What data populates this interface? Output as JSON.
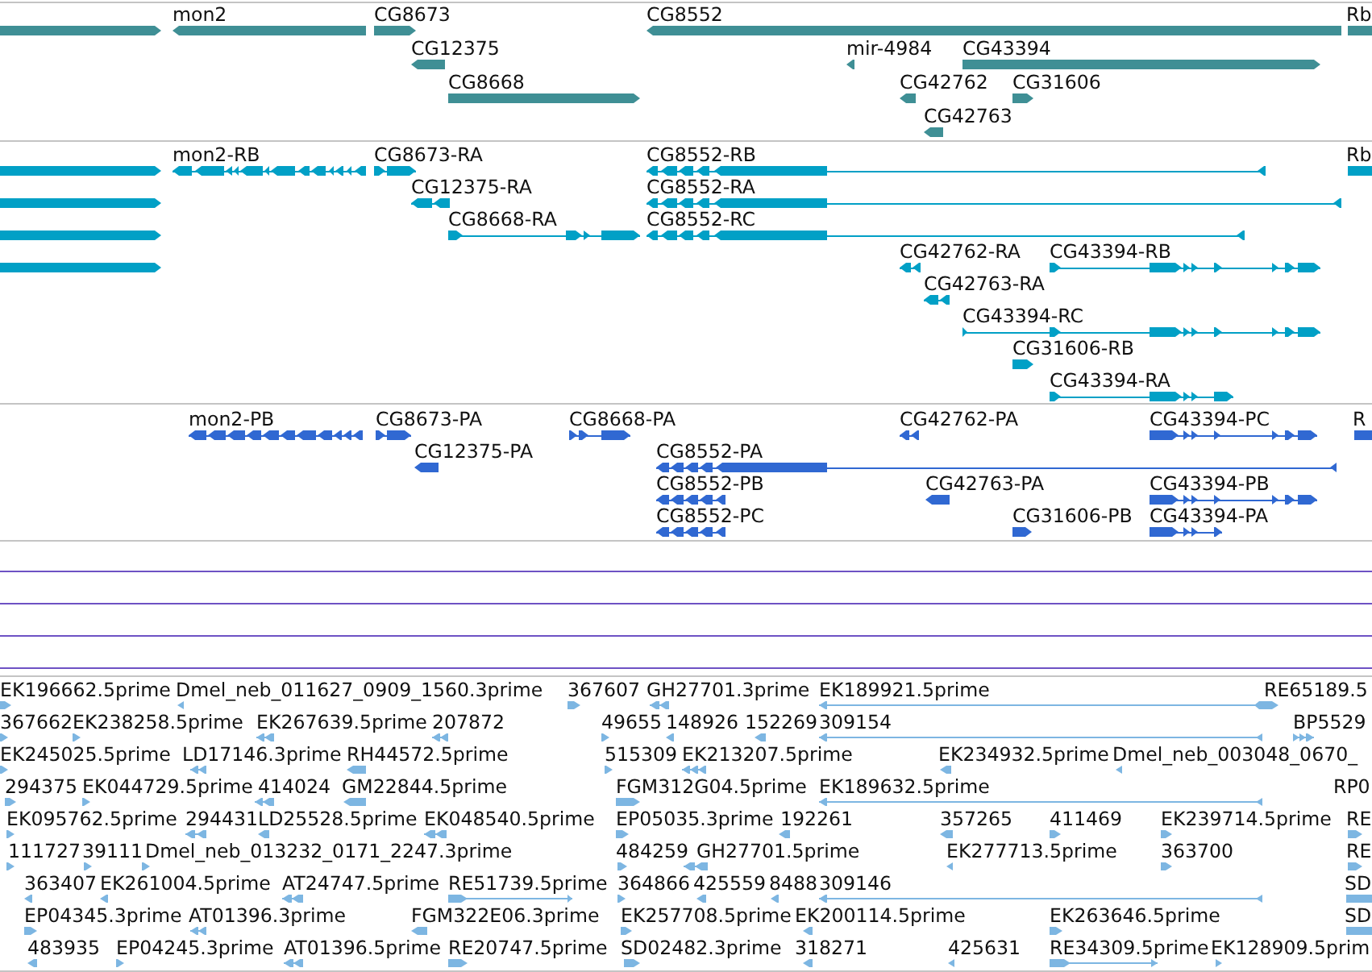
{
  "tracks": [
    {
      "kind": "genes",
      "color": "#3f8f95",
      "features": [
        {
          "reverse": false
        },
        {
          "label": "mon2",
          "reverse": true
        },
        {
          "label": "CG8673",
          "reverse": false
        },
        {
          "label": "CG8552",
          "reverse": true
        },
        {
          "label": "Rb"
        },
        {
          "label": "CG12375",
          "reverse": true
        },
        {
          "label": "mir-4984",
          "reverse": true
        },
        {
          "label": "CG43394",
          "reverse": false
        },
        {
          "label": "CG8668",
          "reverse": false
        },
        {
          "label": "CG42762",
          "reverse": true
        },
        {
          "label": "CG31606",
          "reverse": false
        },
        {
          "label": "CG42763",
          "reverse": true
        }
      ]
    },
    {
      "kind": "transcripts",
      "color": "#01a0c6",
      "features": [
        {
          "reverse": false
        },
        {
          "label": "mon2-RB",
          "reverse": true
        },
        {
          "label": "CG8673-RA",
          "reverse": false
        },
        {
          "label": "CG8552-RB",
          "reverse": true
        },
        {
          "label": "Rb"
        },
        {
          "reverse": false
        },
        {
          "label": "CG12375-RA",
          "reverse": true
        },
        {
          "label": "CG8552-RA",
          "reverse": true
        },
        {
          "reverse": false
        },
        {
          "label": "CG8668-RA",
          "reverse": false
        },
        {
          "label": "CG8552-RC",
          "reverse": true
        },
        {
          "reverse": false
        },
        {
          "label": "CG42762-RA",
          "reverse": true
        },
        {
          "label": "CG43394-RB",
          "reverse": false
        },
        {
          "label": "CG42763-RA",
          "reverse": true
        },
        {
          "label": "CG43394-RC",
          "reverse": false
        },
        {
          "label": "CG31606-RB",
          "reverse": false
        },
        {
          "label": "CG43394-RA",
          "reverse": false
        }
      ]
    },
    {
      "kind": "proteins",
      "color": "#3068d2",
      "features": [
        {
          "label": "mon2-PB",
          "reverse": true
        },
        {
          "label": "CG8673-PA",
          "reverse": false
        },
        {
          "label": "CG8668-PA",
          "reverse": false
        },
        {
          "label": "CG42762-PA",
          "reverse": true
        },
        {
          "label": "CG43394-PC",
          "reverse": false
        },
        {
          "label": "R"
        },
        {
          "label": "CG12375-PA",
          "reverse": true
        },
        {
          "label": "CG8552-PA",
          "reverse": true
        },
        {
          "label": "CG8552-PB",
          "reverse": true
        },
        {
          "label": "CG42763-PA",
          "reverse": true
        },
        {
          "label": "CG43394-PB",
          "reverse": false
        },
        {
          "label": "CG8552-PC",
          "reverse": true
        },
        {
          "label": "CG31606-PB",
          "reverse": false
        },
        {
          "label": "CG43394-PA",
          "reverse": false
        }
      ]
    },
    {
      "kind": "lines",
      "color": "#6e52c4",
      "lines": [
        {
          "kind": "baseline"
        },
        {
          "kind": "baseline"
        },
        {
          "kind": "baseline"
        },
        {
          "kind": "baseline"
        }
      ]
    },
    {
      "kind": "ests",
      "color": "#7db6e2",
      "features": [
        {
          "label": "EK196662.5prime",
          "reverse": false
        },
        {
          "label": "Dmel_neb_011627_0909_1560.3prime",
          "reverse": true
        },
        {
          "label": "367607",
          "reverse": false
        },
        {
          "label": "GH27701.3prime",
          "reverse": true
        },
        {
          "label": "EK189921.5prime",
          "reverse": true
        },
        {
          "label": "RE65189.5",
          "reverse": false
        },
        {
          "label": "367662",
          "reverse": false
        },
        {
          "label": "EK238258.5prime",
          "reverse": false
        },
        {
          "label": "EK267639.5prime",
          "reverse": true
        },
        {
          "label": "207872",
          "reverse": true
        },
        {
          "label": "49655",
          "reverse": false
        },
        {
          "label": "148926",
          "reverse": true
        },
        {
          "label": "152269",
          "reverse": true
        },
        {
          "label": "309154",
          "reverse": true
        },
        {
          "label": "BP5529",
          "reverse": false
        },
        {
          "label": "EK245025.5prime",
          "reverse": false
        },
        {
          "label": "LD17146.3prime",
          "reverse": true
        },
        {
          "label": "RH44572.5prime",
          "reverse": true
        },
        {
          "label": "515309",
          "reverse": false
        },
        {
          "label": "EK213207.5prime",
          "reverse": true
        },
        {
          "label": "EK234932.5prime",
          "reverse": true
        },
        {
          "label": "Dmel_neb_003048_0670_",
          "reverse": true
        },
        {
          "label": "294375",
          "reverse": false
        },
        {
          "label": "EK044729.5prime",
          "reverse": false
        },
        {
          "label": "414024",
          "reverse": true
        },
        {
          "label": "GM22844.5prime",
          "reverse": true
        },
        {
          "label": "FGM312G04.5prime",
          "reverse": false
        },
        {
          "label": "EK189632.5prime",
          "reverse": true
        },
        {
          "label": "RP0"
        },
        {
          "label": "EK095762.5prime",
          "reverse": false
        },
        {
          "label": "294431",
          "reverse": true
        },
        {
          "label": "LD25528.5prime",
          "reverse": true
        },
        {
          "label": "EK048540.5prime",
          "reverse": true
        },
        {
          "label": "EP05035.3prime",
          "reverse": false
        },
        {
          "label": "192261",
          "reverse": true
        },
        {
          "label": "357265",
          "reverse": true
        },
        {
          "label": "411469",
          "reverse": false
        },
        {
          "label": "EK239714.5prime",
          "reverse": false
        },
        {
          "label": "RE",
          "reverse": false
        },
        {
          "label": "111727",
          "reverse": false
        },
        {
          "label": "39111",
          "reverse": false
        },
        {
          "label": "Dmel_neb_013232_0171_2247.3prime",
          "reverse": false
        },
        {
          "label": "484259",
          "reverse": false
        },
        {
          "label": "GH27701.5prime",
          "reverse": true
        },
        {
          "label": "EK277713.5prime",
          "reverse": true
        },
        {
          "label": "363700",
          "reverse": false
        },
        {
          "label": "RE",
          "reverse": false
        },
        {
          "label": "363407",
          "reverse": true
        },
        {
          "label": "EK261004.5prime",
          "reverse": true
        },
        {
          "label": "AT24747.5prime",
          "reverse": true
        },
        {
          "label": "RE51739.5prime",
          "reverse": false
        },
        {
          "label": "364866",
          "reverse": false
        },
        {
          "label": "425559",
          "reverse": true
        },
        {
          "label": "8488",
          "reverse": true
        },
        {
          "label": "309146",
          "reverse": true
        },
        {
          "label": "SD"
        },
        {
          "label": "EP04345.3prime",
          "reverse": false
        },
        {
          "label": "AT01396.3prime",
          "reverse": true
        },
        {
          "label": "FGM322E06.3prime",
          "reverse": true
        },
        {
          "label": "EK257708.5prime",
          "reverse": false
        },
        {
          "label": "EK200114.5prime",
          "reverse": true
        },
        {
          "label": "EK263646.5prime",
          "reverse": false
        },
        {
          "label": "SD"
        },
        {
          "label": "483935",
          "reverse": true
        },
        {
          "label": "EP04245.3prime",
          "reverse": false
        },
        {
          "label": "AT01396.5prime",
          "reverse": true
        },
        {
          "label": "RE20747.5prime",
          "reverse": false
        },
        {
          "label": "SD02482.3prime",
          "reverse": false
        },
        {
          "label": "318271",
          "reverse": true
        },
        {
          "label": "425631",
          "reverse": true
        },
        {
          "label": "RE34309.5prime",
          "reverse": false
        },
        {
          "label": "EK128909.5prim",
          "reverse": false
        }
      ]
    }
  ]
}
